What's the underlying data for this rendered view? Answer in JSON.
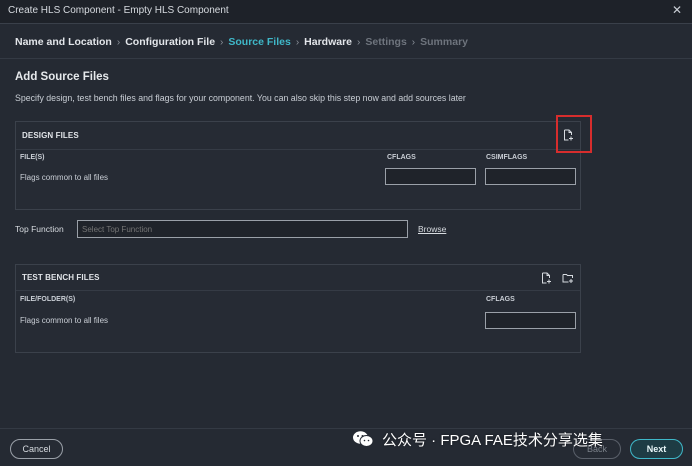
{
  "window": {
    "title": "Create HLS Component - Empty HLS Component",
    "close_glyph": "✕"
  },
  "steps": [
    {
      "label": "Name and Location",
      "state": "done"
    },
    {
      "label": "Configuration File",
      "state": "done"
    },
    {
      "label": "Source Files",
      "state": "active"
    },
    {
      "label": "Hardware",
      "state": "done"
    },
    {
      "label": "Settings",
      "state": "disabled"
    },
    {
      "label": "Summary",
      "state": "disabled"
    }
  ],
  "step_separator": "›",
  "page": {
    "title": "Add Source Files",
    "description": "Specify design, test bench files and flags for your component. You can also skip this step now and add sources later"
  },
  "design_files": {
    "title": "DESIGN FILES",
    "columns": [
      "FILE(S)",
      "CFLAGS",
      "CSIMFLAGS"
    ],
    "row_label": "Flags common to all files",
    "cflags_value": "",
    "csimflags_value": "",
    "icons": [
      "add-file-icon"
    ]
  },
  "top_function": {
    "label": "Top Function",
    "placeholder": "Select Top Function",
    "value": "",
    "browse_label": "Browse"
  },
  "test_bench_files": {
    "title": "TEST BENCH FILES",
    "columns": [
      "FILE/FOLDER(S)",
      "CFLAGS"
    ],
    "row_label": "Flags common to all files",
    "cflags_value": "",
    "icons": [
      "add-file-icon",
      "add-folder-icon"
    ]
  },
  "buttons": {
    "cancel": "Cancel",
    "back": "Back",
    "next": "Next"
  },
  "watermark": {
    "text": "公众号 · FPGA FAE技术分享选集"
  },
  "colors": {
    "background": "#252a33",
    "accent": "#3fb8c9",
    "highlight": "#d72d2d"
  }
}
